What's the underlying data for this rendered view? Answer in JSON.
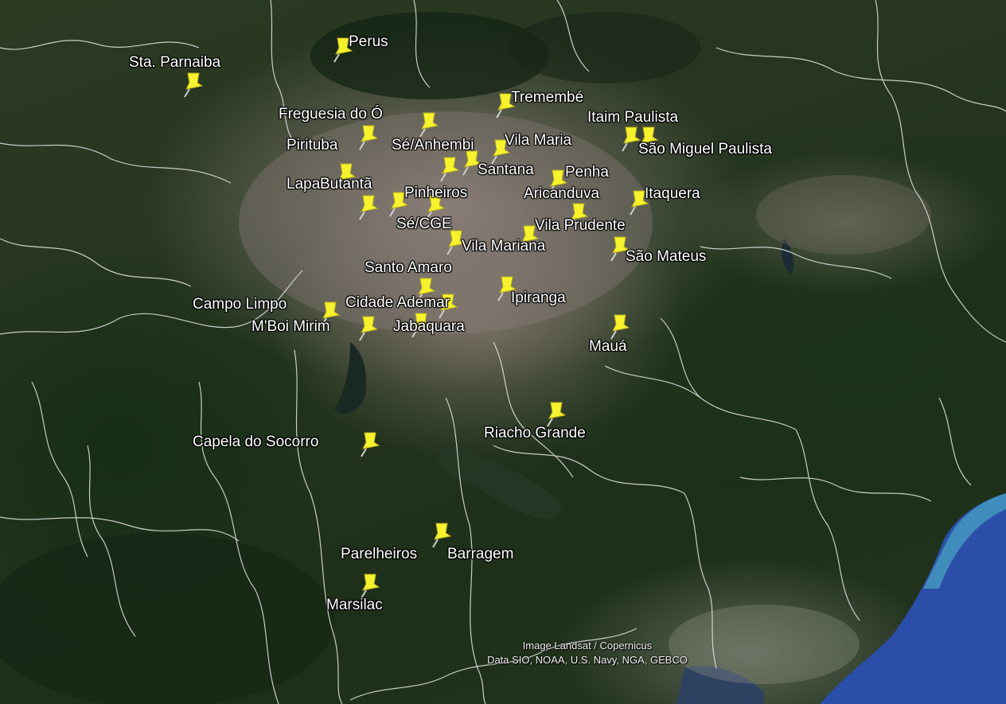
{
  "map": {
    "imagery": "satellite",
    "pin_color": "#f6f32e",
    "label_color": "#ffffff",
    "boundary_color": "#e8e8e8",
    "ocean_color": "#2b4fa8",
    "labels": {
      "perus": "Perus",
      "sta_parnaiba": "Sta. Parnaiba",
      "tremembe": "Tremembé",
      "freguesia": "Freguesia do Ó",
      "itaim": "Itaim Paulista",
      "pirituba": "Pirituba",
      "se_anhembi": "Sé/Anhembi",
      "vila_maria": "Vila Maria",
      "sao_miguel": "São Miguel Paulista",
      "santana": "Santana",
      "penha": "Penha",
      "lapa": "Lapa",
      "butanta": "Butantã",
      "pinheiros": "Pinheiros",
      "aricanduva": "Aricanduva",
      "itaquera": "Itaquera",
      "se_cge": "Sé/CGE",
      "vila_prudente": "Vila Prudente",
      "vila_mariana": "Vila Mariana",
      "sao_mateus": "São Mateus",
      "santo_amaro": "Santo Amaro",
      "campo_limpo": "Campo Limpo",
      "cidade_ademar": "Cidade Ademar",
      "ipiranga": "Ipiranga",
      "mboi_mirim": "M'Boi Mirim",
      "jabaquara": "Jabaquara",
      "maua": "Mauá",
      "riacho_grande": "Riacho Grande",
      "capela": "Capela do Socorro",
      "parelheiros": "Parelheiros",
      "barragem": "Barragem",
      "marsilac": "Marsilac"
    },
    "attribution": {
      "line1": "Image Landsat / Copernicus",
      "line2": "Data SIO, NOAA, U.S. Navy, NGA, GEBCO"
    }
  }
}
